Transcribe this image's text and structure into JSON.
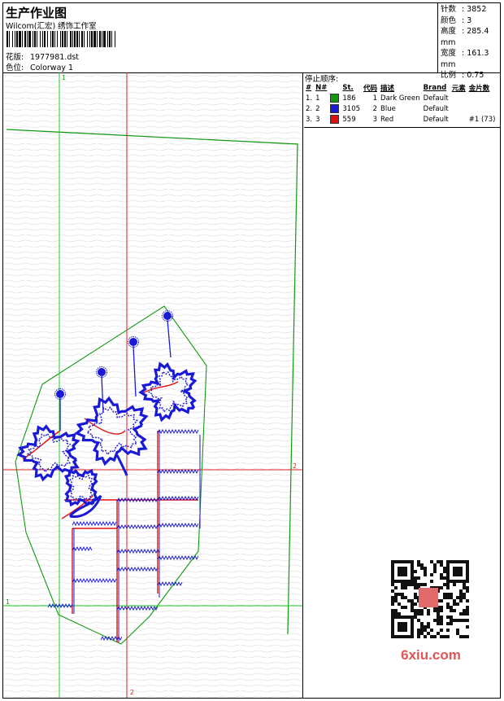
{
  "header": {
    "title": "生产作业图",
    "studio": "Wilcom(汇宏) 绣饰工作室",
    "design_label": "花版:",
    "design_value": "1977981.dst",
    "colorway_label": "色位:",
    "colorway_value": "Colorway 1"
  },
  "stats": [
    {
      "label": "针数",
      "value": ": 3852"
    },
    {
      "label": "颜色",
      "value": ": 3"
    },
    {
      "label": "高度",
      "value": ": 285.4 mm"
    },
    {
      "label": "宽度",
      "value": ": 161.3 mm"
    },
    {
      "label": "比例",
      "value": ": 0.75"
    }
  ],
  "stop_sequence": {
    "title": "停止顺序:",
    "columns": [
      "#",
      "N#",
      "St.",
      "代码",
      "描述",
      "Brand",
      "元素",
      "金片数"
    ],
    "rows": [
      {
        "num": "1.",
        "n": "1",
        "color": "#119911",
        "st": "186",
        "code": "1",
        "desc": "Dark Green",
        "brand": "Default",
        "element": "",
        "sequins": ""
      },
      {
        "num": "2.",
        "n": "2",
        "color": "#1a1ad6",
        "st": "3105",
        "code": "2",
        "desc": "Blue",
        "brand": "Default",
        "element": "",
        "sequins": ""
      },
      {
        "num": "3.",
        "n": "3",
        "color": "#e01010",
        "st": "559",
        "code": "3",
        "desc": "Red",
        "brand": "Default",
        "element": "",
        "sequins": "#1 (73)"
      }
    ]
  },
  "guides": {
    "v1_label": "1",
    "v2_label": "2",
    "h1_label": "1",
    "h2_label": "2"
  },
  "colors": {
    "green": "#119911",
    "blue": "#1a1ad6",
    "red": "#e01010",
    "guide_green": "#22cc22",
    "guide_red": "#e02020"
  },
  "watermark": {
    "text": "6xiu.com"
  }
}
